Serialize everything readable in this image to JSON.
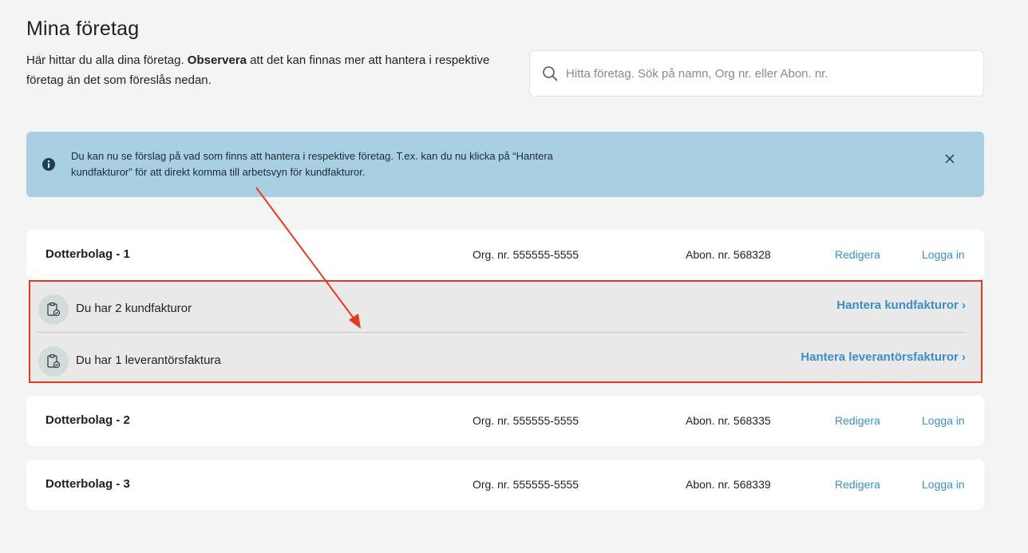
{
  "page": {
    "title": "Mina företag",
    "intro_before": "Här hittar du alla dina företag. ",
    "intro_bold": "Observera",
    "intro_after": " att det kan finnas mer att hantera i respektive företag än det som föreslås nedan."
  },
  "search": {
    "placeholder": "Hitta företag. Sök på namn, Org nr. eller Abon. nr.",
    "value": ""
  },
  "info_banner": {
    "text": "Du kan nu se förslag på vad som finns att hantera i respektive företag. T.ex. kan du nu klicka på “Hantera kundfakturor” för att direkt komma till arbetsvyn för kundfakturor.",
    "icon": "info-icon",
    "close_icon": "close-icon"
  },
  "companies": [
    {
      "name": "Dotterbolag - 1",
      "org": "Org. nr. 555555-5555",
      "abon": "Abon. nr. 568328",
      "edit": "Redigera",
      "login": "Logga in"
    },
    {
      "name": "Dotterbolag - 2",
      "org": "Org. nr. 555555-5555",
      "abon": "Abon. nr. 568335",
      "edit": "Redigera",
      "login": "Logga in"
    },
    {
      "name": "Dotterbolag - 3",
      "org": "Org. nr. 555555-5555",
      "abon": "Abon. nr. 568339",
      "edit": "Redigera",
      "login": "Logga in"
    }
  ],
  "suggestions": [
    {
      "text": "Du har 2 kundfakturor",
      "action": "Hantera kundfakturor ›",
      "icon": "clipboard-check-icon"
    },
    {
      "text": "Du har 1 leverantörsfaktura",
      "action": "Hantera leverantörsfakturor ›",
      "icon": "clipboard-check-icon"
    }
  ],
  "colors": {
    "link": "#3a8fc8",
    "banner_bg": "#a8d0e2",
    "highlight_border": "#e53a1e",
    "page_bg": "#f4f4f4"
  }
}
